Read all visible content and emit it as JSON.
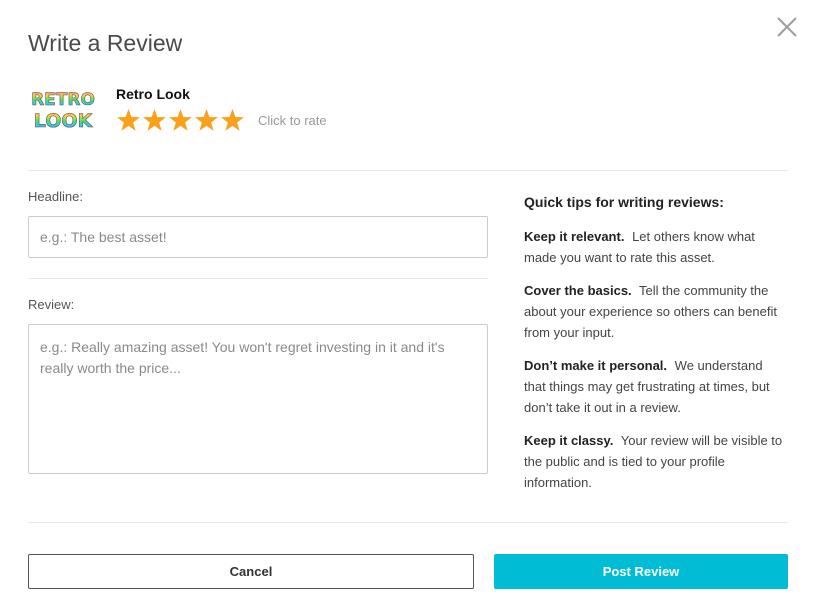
{
  "dialog": {
    "title": "Write a Review"
  },
  "asset": {
    "name": "Retro Look",
    "logo_text": "RETRO LOOK",
    "rating": 5,
    "rating_max": 5,
    "rate_hint": "Click to rate"
  },
  "form": {
    "headline_label": "Headline:",
    "headline_placeholder": "e.g.: The best asset!",
    "headline_value": "",
    "review_label": "Review:",
    "review_placeholder": "e.g.: Really amazing asset! You won't regret investing in it and it's really worth the price...",
    "review_value": ""
  },
  "tips": {
    "title": "Quick tips for writing reviews:",
    "items": [
      {
        "heading": "Keep it relevant.",
        "text": "Let others know what made you want to rate this asset."
      },
      {
        "heading": "Cover the basics.",
        "text": "Tell the community the about your experience so others can benefit from your input."
      },
      {
        "heading": "Don’t make it personal.",
        "text": "We understand that things may get frustrating at times, but don’t take it out in a review."
      },
      {
        "heading": "Keep it classy.",
        "text": "Your review will be visible to the public and is tied to your profile information."
      }
    ]
  },
  "actions": {
    "cancel_label": "Cancel",
    "post_label": "Post Review"
  },
  "colors": {
    "star": "#f9a11b",
    "primary": "#00bcd4",
    "divider": "#e8e8e8"
  },
  "icons": {
    "close": "close-icon",
    "star": "star-icon"
  }
}
